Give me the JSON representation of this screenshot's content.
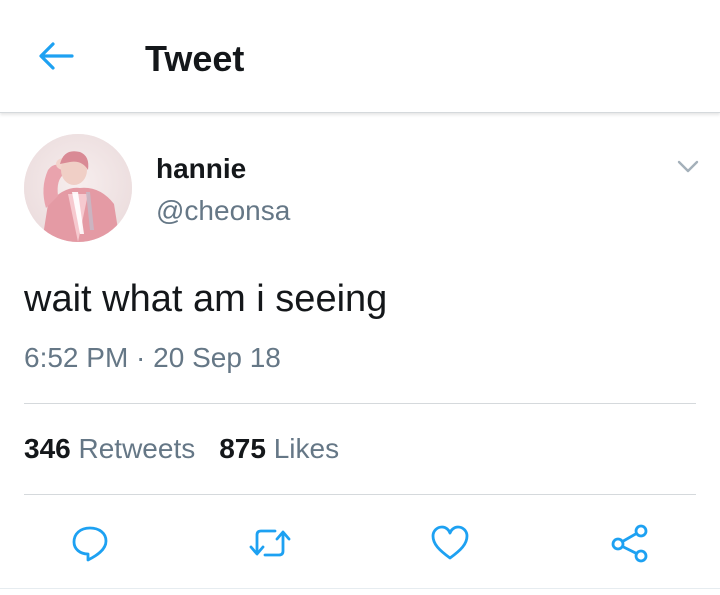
{
  "header": {
    "title": "Tweet",
    "back_icon": "arrow-left-icon"
  },
  "tweet": {
    "display_name": "hannie",
    "handle": "@cheonsa",
    "text": "wait what am i seeing",
    "time": "6:52 PM",
    "separator": " · ",
    "date": "20 Sep 18",
    "retweet_count": "346",
    "retweet_label": "Retweets",
    "like_count": "875",
    "like_label": "Likes",
    "avatar_icon": "user-avatar",
    "caret_icon": "chevron-down-icon"
  },
  "actions": [
    {
      "name": "reply",
      "icon": "speech-bubble-icon"
    },
    {
      "name": "retweet",
      "icon": "retweet-icon"
    },
    {
      "name": "like",
      "icon": "heart-icon"
    },
    {
      "name": "share",
      "icon": "share-icon"
    }
  ],
  "colors": {
    "accent": "#1da1f2",
    "text_primary": "#14171a",
    "text_secondary": "#657786",
    "divider": "#d5d9dc"
  }
}
